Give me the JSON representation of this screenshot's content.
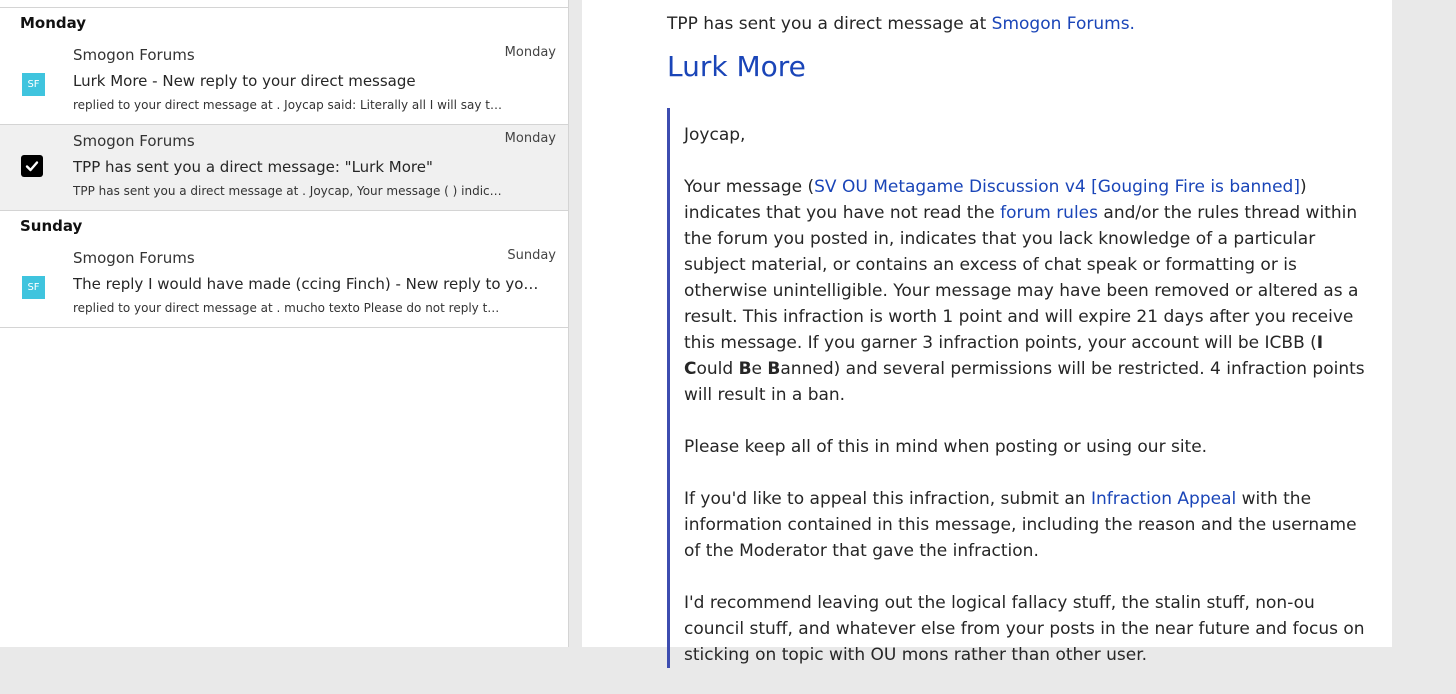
{
  "list": {
    "groups": [
      {
        "label": "Monday",
        "items": [
          {
            "sender": "Smogon Forums",
            "date": "Monday",
            "subject": "Lurk More - New reply to your direct message",
            "preview": "replied to your direct message at . Joycap said: Literally all I will say to thi",
            "avatar": "SF"
          },
          {
            "sender": "Smogon Forums",
            "date": "Monday",
            "subject": "TPP has sent you a direct message: \"Lurk More\"",
            "preview": "TPP has sent you a direct message at . Joycap, Your message ( ) indicates ...",
            "selected": true
          }
        ]
      },
      {
        "label": "Sunday",
        "items": [
          {
            "sender": "Smogon Forums",
            "date": "Sunday",
            "subject": "The reply I would have made (ccing Finch) - New reply to your direct message",
            "preview": "replied to your direct message at . mucho texto Please do not reply to this message",
            "avatar": "SF"
          }
        ]
      }
    ]
  },
  "reader": {
    "intro_text": "TPP has sent you a direct message at ",
    "intro_link": "Smogon Forums.",
    "title": "Lurk More",
    "greeting": "Joycap,",
    "p1_a": "Your message (",
    "p1_link1": "SV OU Metagame Discussion v4 [Gouging Fire is banned]",
    "p1_b": ") indicates that you have not read the ",
    "p1_link2": "forum rules",
    "p1_c": " and/or the rules thread within the forum you posted in, indicates that you lack knowledge of a particular subject material, or contains an excess of chat speak or formatting or is otherwise unintelligible. Your message may have been removed or altered as a result. This infraction is worth 1 point and will expire 21 days after you receive this message. If you garner 3 infraction points, your account will be ICBB (",
    "icbb_i": "I",
    "icbb_c": "C",
    "icbb_ould": "ould ",
    "icbb_b1": "B",
    "icbb_e": "e ",
    "icbb_b2": "B",
    "icbb_anned": "anned",
    "p1_d": ") and several permissions will be restricted. 4 infraction points will result in a ban.",
    "p2": "Please keep all of this in mind when posting or using our site.",
    "p3_a": "If you'd like to appeal this infraction, submit an ",
    "p3_link": "Infraction Appeal",
    "p3_b": " with the information contained in this message, including the reason and the username of the Moderator that gave the infraction.",
    "p4": "I'd recommend leaving out the logical fallacy stuff, the stalin stuff, non-ou council stuff, and whatever else from your posts in the near future and focus on sticking on topic with OU mons rather than other user."
  },
  "colors": {
    "link": "#1a45b8",
    "avatar_bg": "#3fc4de",
    "quote_border": "#3d4db0",
    "selected_bg": "#f0f0f0"
  },
  "icons": {
    "avatar": "sf-avatar-icon",
    "checkbox": "checkbox-checked-icon"
  }
}
